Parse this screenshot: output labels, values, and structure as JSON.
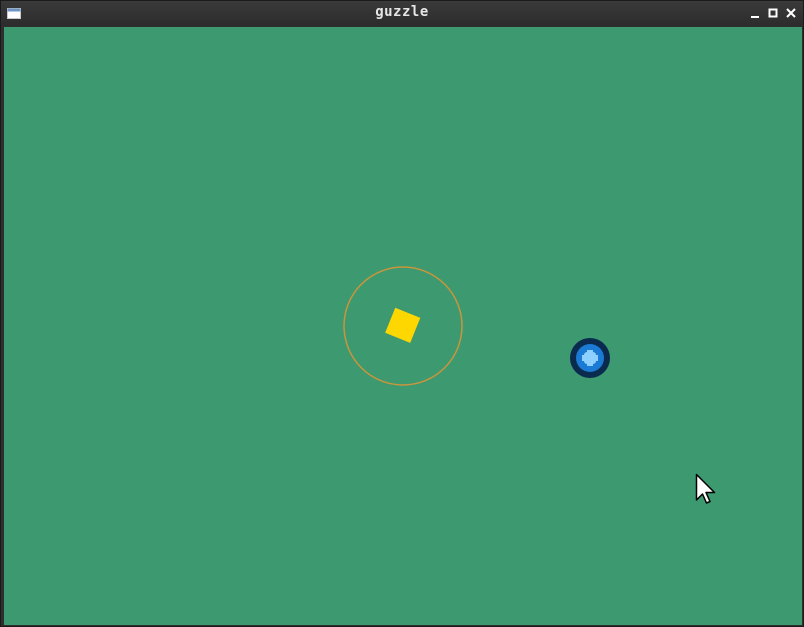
{
  "window": {
    "title": "guzzle"
  },
  "colors": {
    "background": "#3d9970",
    "ring": "#c8963c",
    "diamond": "#ffd700",
    "orb_outer": "#0a2a4e",
    "orb_middle": "#1a7ad4",
    "orb_inner": "#8ed0ff"
  },
  "icons": {
    "app": "window-icon",
    "minimize": "minimize-icon",
    "maximize": "maximize-icon",
    "close": "close-icon",
    "cursor": "mouse-pointer-icon"
  }
}
